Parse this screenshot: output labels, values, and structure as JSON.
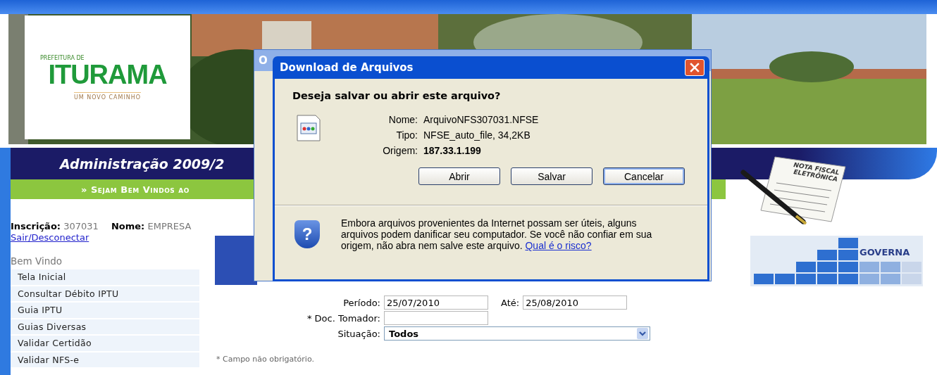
{
  "header": {
    "logo": {
      "tagline": "PREFEITURA DE",
      "name": "ITURAMA",
      "slogan": "UM NOVO CAMINHO"
    },
    "title": "Administração 2009/2",
    "welcome": "» Sejam Bem Vindos ao",
    "badge": {
      "line_1": "NOTA FISCAL",
      "line_2": "ELETRÔNICA"
    }
  },
  "user": {
    "registration_label": "Inscrição:",
    "registration": "307031",
    "name_label": "Nome:",
    "name": "EMPRESA",
    "logout_link": "Sair/Desconectar"
  },
  "menu": {
    "title": "Bem Vindo",
    "items": [
      "Tela Inicial",
      "Consultar Débito IPTU",
      "Guia IPTU",
      "Guias Diversas",
      "Validar Certidão",
      "Validar NFS-e"
    ]
  },
  "brand": "GOVERNA",
  "form": {
    "period": {
      "label": "Período:",
      "value": "25/07/2010"
    },
    "until": {
      "label": "Até:",
      "value": "25/08/2010"
    },
    "taker_doc": {
      "label": "* Doc. Tomador:"
    },
    "status": {
      "label": "Situação:",
      "value": "Todos"
    },
    "note": "* Campo não obrigatório."
  },
  "background_window": {
    "title": "O"
  },
  "dialog": {
    "title": "Download de Arquivos",
    "question": "Deseja salvar ou abrir este arquivo?",
    "details": [
      {
        "label": "Nome:",
        "value": "ArquivoNFS307031.NFSE",
        "bold": false
      },
      {
        "label": "Tipo:",
        "value": "NFSE_auto_file, 34,2KB",
        "bold": false
      },
      {
        "label": "Origem:",
        "value": "187.33.1.199",
        "bold": true
      }
    ],
    "buttons": [
      {
        "label": "Abrir",
        "focused": false
      },
      {
        "label": "Salvar",
        "focused": false
      },
      {
        "label": "Cancelar",
        "focused": true
      }
    ],
    "shield_mark": "?",
    "warning": "Embora arquivos provenientes da Internet possam ser úteis, alguns arquivos podem danificar seu computador. Se você não confiar em sua origem, não abra nem salve este arquivo.",
    "risk_link": "Qual é o risco?"
  }
}
